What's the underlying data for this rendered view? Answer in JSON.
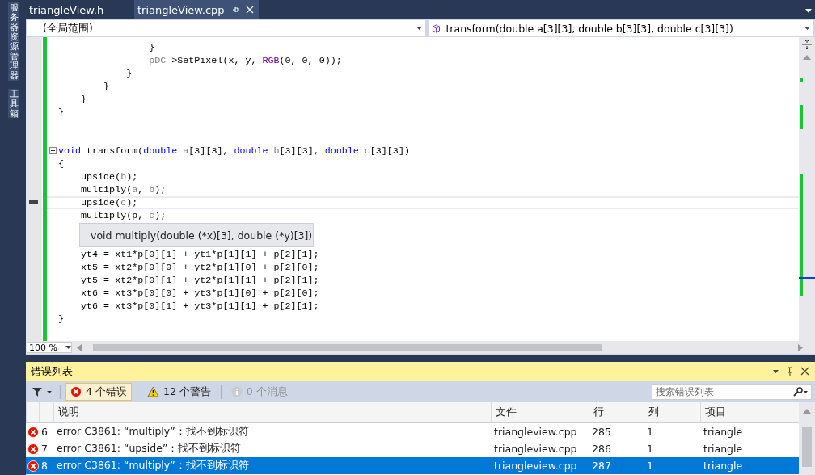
{
  "side_tabs": [
    {
      "label": "服务器资源管理器"
    },
    {
      "label": "工具箱"
    }
  ],
  "tabs": [
    {
      "label": "triangleView.h",
      "selected": false
    },
    {
      "label": "triangleView.cpp",
      "selected": true
    }
  ],
  "scope_dropdown": {
    "value": "(全局范围)"
  },
  "member_dropdown": {
    "value": "transform(double a[3][3], double b[3][3], double c[3][3])"
  },
  "code_blocks": [
    {
      "lines": [
        {
          "tokens": [
            {
              "kind": "plain",
              "text": "                }"
            }
          ]
        },
        {
          "tokens": [
            {
              "kind": "param",
              "text": "                pDC"
            },
            {
              "kind": "plain",
              "text": "->SetPixel(x, y, "
            },
            {
              "kind": "macro",
              "text": "RGB"
            },
            {
              "kind": "plain",
              "text": "(0, 0, 0));"
            }
          ]
        },
        {
          "tokens": [
            {
              "kind": "plain",
              "text": "            }"
            }
          ]
        },
        {
          "tokens": [
            {
              "kind": "plain",
              "text": "        }"
            }
          ]
        },
        {
          "tokens": [
            {
              "kind": "plain",
              "text": "    }"
            }
          ]
        },
        {
          "tokens": [
            {
              "kind": "plain",
              "text": "}"
            }
          ]
        }
      ]
    },
    {
      "lines": [
        {
          "fold": true,
          "tokens": [
            {
              "kind": "keyword",
              "text": "void"
            },
            {
              "kind": "plain",
              "text": " transform("
            },
            {
              "kind": "keyword",
              "text": "double"
            },
            {
              "kind": "param",
              "text": " a"
            },
            {
              "kind": "plain",
              "text": "[3][3], "
            },
            {
              "kind": "keyword",
              "text": "double"
            },
            {
              "kind": "param",
              "text": " b"
            },
            {
              "kind": "plain",
              "text": "[3][3], "
            },
            {
              "kind": "keyword",
              "text": "double"
            },
            {
              "kind": "param",
              "text": " c"
            },
            {
              "kind": "plain",
              "text": "[3][3])"
            }
          ]
        },
        {
          "tokens": [
            {
              "kind": "plain",
              "text": "{"
            }
          ]
        },
        {
          "tokens": [
            {
              "kind": "plain",
              "text": "    upside("
            },
            {
              "kind": "param",
              "text": "b"
            },
            {
              "kind": "plain",
              "text": ");"
            }
          ]
        },
        {
          "tokens": [
            {
              "kind": "plain",
              "text": "    multiply("
            },
            {
              "kind": "param",
              "text": "a"
            },
            {
              "kind": "plain",
              "text": ", "
            },
            {
              "kind": "param",
              "text": "b"
            },
            {
              "kind": "plain",
              "text": ");"
            }
          ]
        },
        {
          "current": true,
          "tokens": [
            {
              "kind": "plain",
              "text": "    upside("
            },
            {
              "kind": "param",
              "text": "c"
            },
            {
              "kind": "plain",
              "text": ");"
            }
          ]
        },
        {
          "tokens": [
            {
              "kind": "plain",
              "text": "    multiply(p, "
            },
            {
              "kind": "param",
              "text": "c"
            },
            {
              "kind": "plain",
              "text": ");"
            }
          ]
        }
      ]
    },
    {
      "lines": [
        {
          "tokens": [
            {
              "kind": "plain",
              "text": "    yt4 = xt1*p[0][1] + yt1*p[1][1] + p[2][1];"
            }
          ]
        },
        {
          "tokens": [
            {
              "kind": "plain",
              "text": "    xt5 = xt2*p[0][0] + yt2*p[1][0] + p[2][0];"
            }
          ]
        },
        {
          "tokens": [
            {
              "kind": "plain",
              "text": "    yt5 = xt2*p[0][1] + yt2*p[1][1] + p[2][1];"
            }
          ]
        },
        {
          "tokens": [
            {
              "kind": "plain",
              "text": "    xt6 = xt3*p[0][0] + yt3*p[1][0] + p[2][0];"
            }
          ]
        },
        {
          "tokens": [
            {
              "kind": "plain",
              "text": "    yt6 = xt3*p[0][1] + yt3*p[1][1] + p[2][1];"
            }
          ]
        },
        {
          "tokens": [
            {
              "kind": "plain",
              "text": "}"
            }
          ]
        }
      ]
    }
  ],
  "tooltip": {
    "text": "void multiply(double (*x)[3], double (*y)[3])"
  },
  "zoom": {
    "value": "100 %"
  },
  "error_list": {
    "title": "错误列表",
    "filters": [
      {
        "kind": "error",
        "label": "4 个错误",
        "selected": true,
        "disabled": false
      },
      {
        "kind": "warning",
        "label": "12 个警告",
        "selected": false,
        "disabled": false
      },
      {
        "kind": "info",
        "label": "0 个消息",
        "selected": false,
        "disabled": true
      }
    ],
    "search": {
      "placeholder": "搜索错误列表"
    },
    "columns": [
      "说明",
      "文件",
      "行",
      "列",
      "项目"
    ],
    "rows": [
      {
        "number": "6",
        "description": "error C3861: “multiply”：找不到标识符",
        "file": "triangleview.cpp",
        "line": "285",
        "column": "1",
        "project": "triangle",
        "selected": false
      },
      {
        "number": "7",
        "description": "error C3861: “upside”：找不到标识符",
        "file": "triangleview.cpp",
        "line": "286",
        "column": "1",
        "project": "triangle",
        "selected": false
      },
      {
        "number": "8",
        "description": "error C3861: “multiply”：找不到标识符",
        "file": "triangleview.cpp",
        "line": "287",
        "column": "1",
        "project": "triangle",
        "selected": true
      }
    ]
  }
}
